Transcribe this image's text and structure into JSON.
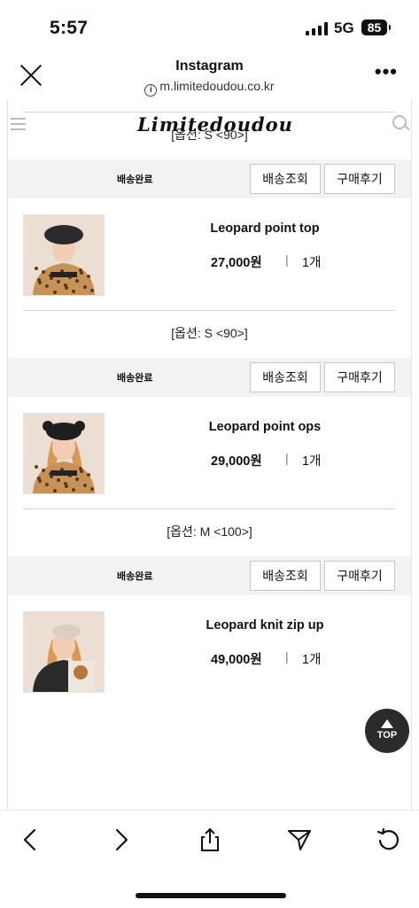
{
  "status": {
    "time": "5:57",
    "network": "5G",
    "battery": "85"
  },
  "browser": {
    "title": "Instagram",
    "url": "m.limitedoudou.co.kr"
  },
  "site": {
    "logo": "Limitedoudou"
  },
  "items": [
    {
      "name": "Leopard knit zip up",
      "price": "49,000원",
      "qty": "1개",
      "option": "[옵션: S <90>]",
      "status": "배송완료",
      "track": "배송조회",
      "review": "구매후기",
      "thumb": "knit"
    },
    {
      "name": "Leopard point top",
      "price": "27,000원",
      "qty": "1개",
      "option": "[옵션: S <90>]",
      "status": "배송완료",
      "track": "배송조회",
      "review": "구매후기",
      "thumb": "top"
    },
    {
      "name": "Leopard point ops",
      "price": "29,000원",
      "qty": "1개",
      "option": "[옵션: M <100>]",
      "status": "배송완료",
      "track": "배송조회",
      "review": "구매후기",
      "thumb": "ops"
    },
    {
      "name": "Leopard knit zip up",
      "price": "49,000원",
      "qty": "1개",
      "option": "",
      "status": "",
      "track": "",
      "review": "",
      "thumb": "knit"
    }
  ],
  "top_button": "TOP"
}
